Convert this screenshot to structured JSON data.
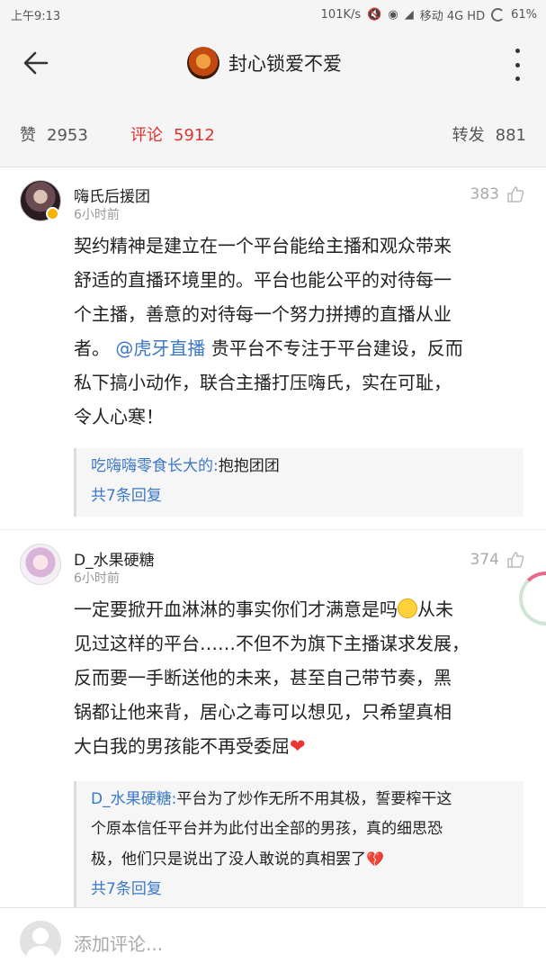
{
  "status_bar": {
    "time": "上午9:13",
    "network_speed": "101K/s",
    "carrier": "移动 4G HD",
    "battery": "61%"
  },
  "header": {
    "title": "封心锁爱不爱"
  },
  "stats": {
    "like_label": "赞",
    "like_count": "2953",
    "comment_label": "评论",
    "comment_count": "5912",
    "repost_label": "转发",
    "repost_count": "881"
  },
  "comments": [
    {
      "username": "嗨氏后援团",
      "time": "6小时前",
      "likes": "383",
      "lines": [
        "契约精神是建立在一个平台能给主播和观众带来",
        "舒适的直播环境里的。平台也能公平的对待每一",
        "个主播，善意的对待每一个努力拼搏的直播从业",
        "者。",
        "私下搞小动作，联合主播打压嗨氏，实在可耻，",
        "令人心寒！"
      ],
      "mention": "@虎牙直播",
      "after_mention": " 贵平台不专注于平台建设，反而",
      "reply_user": "吃嗨嗨零食长大的:",
      "reply_text": "抱抱团团",
      "reply_count": "共7条回复"
    },
    {
      "username": "D_水果硬糖",
      "time": "6小时前",
      "likes": "374",
      "lines": [
        "一定要掀开血淋淋的事实你们才满意是吗",
        "从未",
        "见过这样的平台……不但不为旗下主播谋求发展，",
        "反而要一手断送他的未来，甚至自己带节奏，黑",
        "锅都让他来背，居心之毒可以想见，只希望真相",
        "大白我的男孩能不再受委屈"
      ],
      "reply_user": "D_水果硬糖:",
      "reply_lines": [
        "平台为了炒作无所不用其极，誓要榨干这",
        "个原本信任平台并为此付出全部的男孩，真的细思恐",
        "极，他们只是说出了没人敢说的真相罢了"
      ],
      "reply_count": "共7条回复"
    }
  ],
  "input": {
    "placeholder": "添加评论..."
  },
  "icons": {
    "back": "back-arrow-icon",
    "more": "more-vertical-icon",
    "like": "thumb-up-icon",
    "smile": "smile-emoji-icon",
    "heart": "heart-emoji-icon",
    "broken_heart": "broken-heart-emoji-icon"
  }
}
